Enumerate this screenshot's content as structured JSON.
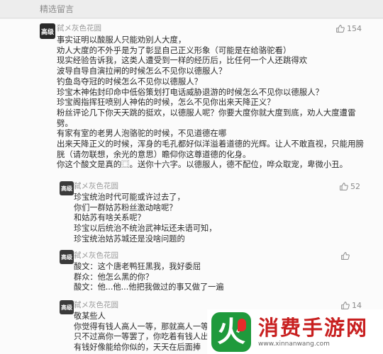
{
  "header": {
    "title": "精选留言"
  },
  "main_comment": {
    "avatar_text": "高级",
    "username": "弑メ灰色花圆",
    "likes": "154",
    "lines": [
      "事实证明以酸服人只能劝别人大度，",
      "劝人大度的不外乎是为了彰显自己正义形象（可能是在给骆驼看）",
      "现实经验告诉我，这类人遭受到一样的经历后，比任何一个人还跳得欢",
      "波导自导自演拉闸的时候怎么不见你以德服人？",
      "钓鱼岛夺冠的时候怎么不见你以德服人？",
      "珍宝木神佑封印命中低俗策划打电话威胁退游的时候怎么不见你以德服人？",
      "珍宝阁指挥狂喷别人神佑的时候，怎么不见你出来天降正义？",
      "粉丝评论几下你天天跳的挺欢，以德服人呢？你要大度你就大度到底，劝人大度遭雷劈。",
      "有家有室的老男人泡骆驼的时候，不见道德在哪",
      "出来天降正义的时候，浑身的毛孔都好似洋溢着道德的光辉。让人不敢直视，只能用膀胱（请勿联想，余光的意思）瞻仰你这尊道德的化身。",
      "你这个酸文是真的⿴。送你十六字。以德服人，德不配位，哗众取宠，卑微小丑。"
    ]
  },
  "replies": [
    {
      "avatar_text": "高级",
      "username": "弑メ灰色花圆",
      "likes": "52",
      "lines": [
        "珍宝统治时代可能或许过去了，",
        "你们一群姑苏粉丝激动啥呢？",
        "和姑苏有啥关系呢？",
        "珍宝以后统治不统治武神坛还未语可知，",
        "珍宝统治姑苏城还是没啥问题的"
      ]
    },
    {
      "avatar_text": "高级",
      "username": "弑メ灰色花园",
      "likes": "",
      "lines": [
        "酸文：这个唐老鸭狂黑我，我好委屈",
        "群众：他怎么黑的你？",
        "酸文：他...他...他把我做过的事又做了一遍"
      ]
    },
    {
      "avatar_text": "高级",
      "username": "弑メ灰色花圆",
      "likes": "14",
      "lines": [
        "敬某些人",
        "你觉得有钱人高人一等，那就高人一等",
        "只不过高你一等罢了，你吃着有钱人出",
        "有钱好像能给你似的，天天在后面捧"
      ]
    }
  ],
  "watermark": {
    "logo_letter": "火",
    "title": "消费手游网",
    "url": "www.xinnanwang.com"
  },
  "colors": {
    "text": "#2b2b2b",
    "meta": "#9a9a9a",
    "watermark_red": "#c82020",
    "logo_green": "#1f9a3c"
  },
  "icons": {
    "like": "thumbs-up-icon"
  }
}
